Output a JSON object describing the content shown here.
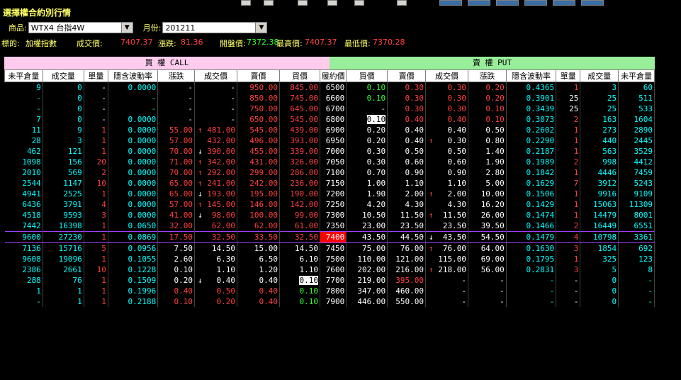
{
  "window": {
    "title": "選擇權合約別行情"
  },
  "filters": {
    "product_label": "商品:",
    "product_value": "WTX4 台指4W",
    "month_label": "月份:",
    "month_value": "201211"
  },
  "underlying": {
    "label": "標的:",
    "name": "加權指數",
    "trade_label": "成交價:",
    "trade_value": "7407.37",
    "change_label": "漲跌:",
    "change_value": "81.36",
    "open_label": "開盤價:",
    "open_value": "7372.38",
    "high_label": "最高價:",
    "high_value": "7407.37",
    "low_label": "最低價:",
    "low_value": "7370.28"
  },
  "sections": {
    "call": "買 權 CALL",
    "put": "賣 權 PUT"
  },
  "headers": [
    "未平倉量",
    "成交量",
    "單量",
    "隱含波動率",
    "漲跌",
    "成交價",
    "賣價",
    "買價",
    "履約價",
    "買價",
    "賣價",
    "成交價",
    "漲跌",
    "隱含波動率",
    "單量",
    "成交量",
    "未平倉量"
  ],
  "colors": {
    "call_header": "#ffccee",
    "put_header": "#99ee99",
    "up": "#ff4040",
    "down": "#33ff33",
    "atm": "#ff0000"
  },
  "rows": [
    {
      "c_oi": "9",
      "c_vol": "0",
      "c_unit": "-",
      "c_iv": "0.0000",
      "c_chg": "-",
      "c_dir": "",
      "c_last": "-",
      "c_ask": "950.00",
      "c_bid": "845.00",
      "strike": "6500",
      "p_bid": "0.10",
      "p_ask": "0.30",
      "p_dir": "",
      "p_last": "0.30",
      "p_chg": "0.20",
      "p_iv": "0.4365",
      "p_unit": "1",
      "p_vol": "3",
      "p_oi": "60"
    },
    {
      "c_oi": "-",
      "c_vol": "0",
      "c_unit": "-",
      "c_iv": "-",
      "c_chg": "-",
      "c_dir": "",
      "c_last": "-",
      "c_ask": "850.00",
      "c_bid": "745.00",
      "strike": "6600",
      "p_bid": "0.10",
      "p_ask": "0.30",
      "p_dir": "",
      "p_last": "0.30",
      "p_chg": "0.20",
      "p_iv": "0.3901",
      "p_unit": "25",
      "p_vol": "25",
      "p_oi": "511"
    },
    {
      "c_oi": "-",
      "c_vol": "0",
      "c_unit": "-",
      "c_iv": "-",
      "c_chg": "-",
      "c_dir": "",
      "c_last": "-",
      "c_ask": "750.00",
      "c_bid": "645.00",
      "strike": "6700",
      "p_bid": "-",
      "p_ask": "0.30",
      "p_dir": "",
      "p_last": "0.30",
      "p_chg": "0.10",
      "p_iv": "0.3439",
      "p_unit": "25",
      "p_vol": "25",
      "p_oi": "533"
    },
    {
      "c_oi": "7",
      "c_vol": "0",
      "c_unit": "-",
      "c_iv": "0.0000",
      "c_chg": "-",
      "c_dir": "",
      "c_last": "-",
      "c_ask": "650.00",
      "c_bid": "545.00",
      "strike": "6800",
      "p_bid": "0.10",
      "p_ask": "0.40",
      "p_dir": "",
      "p_last": "0.40",
      "p_chg": "0.10",
      "p_iv": "0.3073",
      "p_unit": "2",
      "p_vol": "163",
      "p_oi": "1604"
    },
    {
      "c_oi": "11",
      "c_vol": "9",
      "c_unit": "1",
      "c_iv": "0.0000",
      "c_chg": "55.00",
      "c_dir": "up",
      "c_last": "481.00",
      "c_ask": "545.00",
      "c_bid": "439.00",
      "strike": "6900",
      "p_bid": "0.20",
      "p_ask": "0.40",
      "p_dir": "",
      "p_last": "0.40",
      "p_chg": "0.50",
      "p_iv": "0.2602",
      "p_unit": "1",
      "p_vol": "273",
      "p_oi": "2890"
    },
    {
      "c_oi": "28",
      "c_vol": "3",
      "c_unit": "1",
      "c_iv": "0.0000",
      "c_chg": "57.00",
      "c_dir": "",
      "c_last": "432.00",
      "c_ask": "496.00",
      "c_bid": "393.00",
      "strike": "6950",
      "p_bid": "0.20",
      "p_ask": "0.40",
      "p_dir": "up",
      "p_last": "0.30",
      "p_chg": "0.80",
      "p_iv": "0.2290",
      "p_unit": "1",
      "p_vol": "440",
      "p_oi": "2445"
    },
    {
      "c_oi": "462",
      "c_vol": "121",
      "c_unit": "1",
      "c_iv": "0.0000",
      "c_chg": "70.00",
      "c_dir": "down",
      "c_last": "390.00",
      "c_ask": "455.00",
      "c_bid": "339.00",
      "strike": "7000",
      "p_bid": "0.30",
      "p_ask": "0.50",
      "p_dir": "",
      "p_last": "0.50",
      "p_chg": "1.40",
      "p_iv": "0.2187",
      "p_unit": "1",
      "p_vol": "563",
      "p_oi": "3529"
    },
    {
      "c_oi": "1098",
      "c_vol": "156",
      "c_unit": "20",
      "c_iv": "0.0000",
      "c_chg": "71.00",
      "c_dir": "up",
      "c_last": "342.00",
      "c_ask": "431.00",
      "c_bid": "326.00",
      "strike": "7050",
      "p_bid": "0.30",
      "p_ask": "0.60",
      "p_dir": "",
      "p_last": "0.60",
      "p_chg": "1.90",
      "p_iv": "0.1989",
      "p_unit": "2",
      "p_vol": "998",
      "p_oi": "4412"
    },
    {
      "c_oi": "2010",
      "c_vol": "569",
      "c_unit": "2",
      "c_iv": "0.0000",
      "c_chg": "70.00",
      "c_dir": "up",
      "c_last": "292.00",
      "c_ask": "299.00",
      "c_bid": "286.00",
      "strike": "7100",
      "p_bid": "0.70",
      "p_ask": "0.90",
      "p_dir": "",
      "p_last": "0.90",
      "p_chg": "2.80",
      "p_iv": "0.1842",
      "p_unit": "1",
      "p_vol": "4446",
      "p_oi": "7459"
    },
    {
      "c_oi": "2544",
      "c_vol": "1147",
      "c_unit": "10",
      "c_iv": "0.0000",
      "c_chg": "65.00",
      "c_dir": "up",
      "c_last": "241.00",
      "c_ask": "242.00",
      "c_bid": "236.00",
      "strike": "7150",
      "p_bid": "1.00",
      "p_ask": "1.10",
      "p_dir": "",
      "p_last": "1.10",
      "p_chg": "5.00",
      "p_iv": "0.1629",
      "p_unit": "7",
      "p_vol": "3912",
      "p_oi": "5243"
    },
    {
      "c_oi": "4941",
      "c_vol": "2525",
      "c_unit": "1",
      "c_iv": "0.0000",
      "c_chg": "65.00",
      "c_dir": "down",
      "c_last": "193.00",
      "c_ask": "195.00",
      "c_bid": "190.00",
      "strike": "7200",
      "p_bid": "1.90",
      "p_ask": "2.00",
      "p_dir": "up",
      "p_last": "2.00",
      "p_chg": "10.00",
      "p_iv": "0.1506",
      "p_unit": "1",
      "p_vol": "9916",
      "p_oi": "9109"
    },
    {
      "c_oi": "6436",
      "c_vol": "3791",
      "c_unit": "4",
      "c_iv": "0.0000",
      "c_chg": "57.00",
      "c_dir": "up",
      "c_last": "145.00",
      "c_ask": "146.00",
      "c_bid": "142.00",
      "strike": "7250",
      "p_bid": "4.20",
      "p_ask": "4.30",
      "p_dir": "",
      "p_last": "4.30",
      "p_chg": "16.20",
      "p_iv": "0.1429",
      "p_unit": "1",
      "p_vol": "15063",
      "p_oi": "11309"
    },
    {
      "c_oi": "4518",
      "c_vol": "9593",
      "c_unit": "3",
      "c_iv": "0.0000",
      "c_chg": "41.00",
      "c_dir": "down",
      "c_last": "98.00",
      "c_ask": "100.00",
      "c_bid": "99.00",
      "strike": "7300",
      "p_bid": "10.50",
      "p_ask": "11.50",
      "p_dir": "up",
      "p_last": "11.50",
      "p_chg": "26.00",
      "p_iv": "0.1474",
      "p_unit": "1",
      "p_vol": "14479",
      "p_oi": "8001"
    },
    {
      "c_oi": "7442",
      "c_vol": "16398",
      "c_unit": "1",
      "c_iv": "0.0650",
      "c_chg": "32.00",
      "c_dir": "",
      "c_last": "62.00",
      "c_ask": "62.00",
      "c_bid": "61.00",
      "strike": "7350",
      "p_bid": "23.00",
      "p_ask": "23.50",
      "p_dir": "",
      "p_last": "23.50",
      "p_chg": "39.50",
      "p_iv": "0.1466",
      "p_unit": "2",
      "p_vol": "16449",
      "p_oi": "6551"
    },
    {
      "c_oi": "9600",
      "c_vol": "27230",
      "c_unit": "1",
      "c_iv": "0.0869",
      "c_chg": "17.50",
      "c_dir": "",
      "c_last": "32.50",
      "c_ask": "33.50",
      "c_bid": "32.50",
      "strike": "7400",
      "p_bid": "43.50",
      "p_ask": "44.50",
      "p_dir": "down",
      "p_last": "43.50",
      "p_chg": "54.50",
      "p_iv": "0.1479",
      "p_unit": "4",
      "p_vol": "10798",
      "p_oi": "3361"
    },
    {
      "c_oi": "7136",
      "c_vol": "15716",
      "c_unit": "5",
      "c_iv": "0.0956",
      "c_chg": "7.50",
      "c_dir": "",
      "c_last": "14.50",
      "c_ask": "15.00",
      "c_bid": "14.50",
      "strike": "7450",
      "p_bid": "75.00",
      "p_ask": "76.00",
      "p_dir": "up",
      "p_last": "76.00",
      "p_chg": "64.00",
      "p_iv": "0.1630",
      "p_unit": "3",
      "p_vol": "1854",
      "p_oi": "692"
    },
    {
      "c_oi": "9608",
      "c_vol": "19096",
      "c_unit": "1",
      "c_iv": "0.1055",
      "c_chg": "2.60",
      "c_dir": "",
      "c_last": "6.30",
      "c_ask": "6.50",
      "c_bid": "6.10",
      "strike": "7500",
      "p_bid": "110.00",
      "p_ask": "121.00",
      "p_dir": "",
      "p_last": "115.00",
      "p_chg": "69.00",
      "p_iv": "0.1795",
      "p_unit": "1",
      "p_vol": "325",
      "p_oi": "123"
    },
    {
      "c_oi": "2386",
      "c_vol": "2661",
      "c_unit": "10",
      "c_iv": "0.1228",
      "c_chg": "0.10",
      "c_dir": "",
      "c_last": "1.10",
      "c_ask": "1.20",
      "c_bid": "1.10",
      "strike": "7600",
      "p_bid": "202.00",
      "p_ask": "216.00",
      "p_dir": "up",
      "p_last": "218.00",
      "p_chg": "56.00",
      "p_iv": "0.2831",
      "p_unit": "3",
      "p_vol": "5",
      "p_oi": "8"
    },
    {
      "c_oi": "288",
      "c_vol": "76",
      "c_unit": "1",
      "c_iv": "0.1509",
      "c_chg": "0.20",
      "c_dir": "down",
      "c_last": "0.40",
      "c_ask": "0.40",
      "c_bid": "0.10",
      "strike": "7700",
      "p_bid": "219.00",
      "p_ask": "395.00",
      "p_dir": "",
      "p_last": "-",
      "p_chg": "-",
      "p_iv": "-",
      "p_unit": "-",
      "p_vol": "0",
      "p_oi": "-"
    },
    {
      "c_oi": "1",
      "c_vol": "1",
      "c_unit": "1",
      "c_iv": "0.1996",
      "c_chg": "0.40",
      "c_dir": "",
      "c_last": "0.50",
      "c_ask": "0.40",
      "c_bid": "0.10",
      "strike": "7800",
      "p_bid": "347.00",
      "p_ask": "460.00",
      "p_dir": "",
      "p_last": "-",
      "p_chg": "-",
      "p_iv": "-",
      "p_unit": "-",
      "p_vol": "0",
      "p_oi": "-"
    },
    {
      "c_oi": "-",
      "c_vol": "1",
      "c_unit": "1",
      "c_iv": "0.2188",
      "c_chg": "0.10",
      "c_dir": "",
      "c_last": "0.20",
      "c_ask": "0.40",
      "c_bid": "0.10",
      "strike": "7900",
      "p_bid": "446.00",
      "p_ask": "550.00",
      "p_dir": "",
      "p_last": "-",
      "p_chg": "-",
      "p_iv": "-",
      "p_unit": "-",
      "p_vol": "0",
      "p_oi": "-"
    }
  ]
}
